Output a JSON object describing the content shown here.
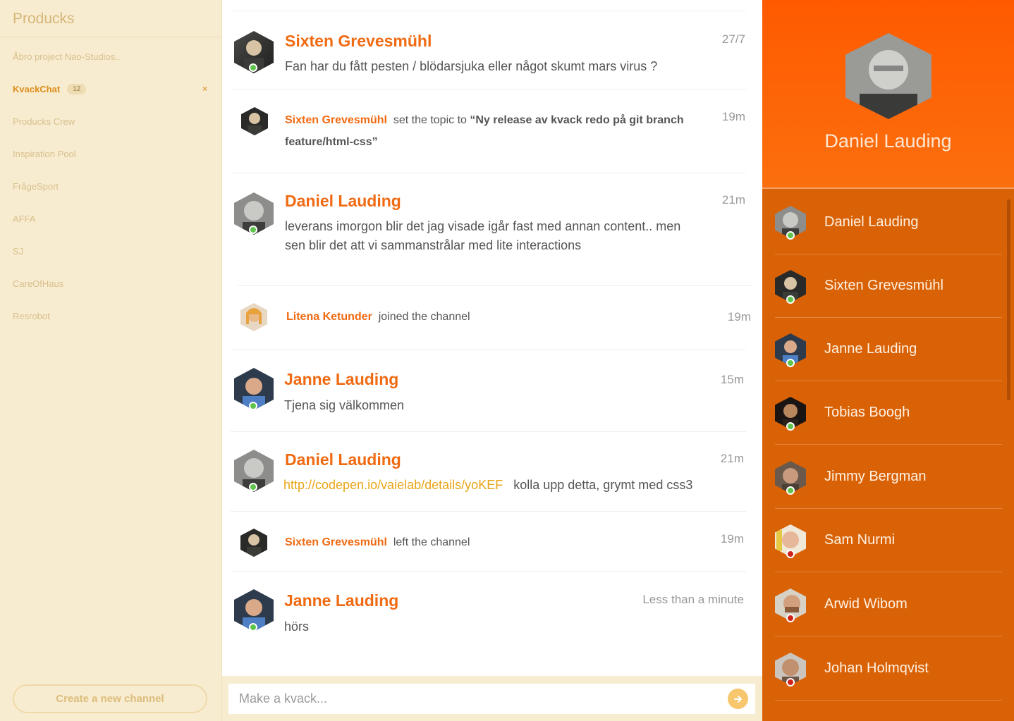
{
  "sidebar": {
    "brand": "Producks",
    "channels": [
      {
        "name": "Åbro project Nao-Studios.."
      },
      {
        "name": "KvackChat",
        "badge": "12",
        "close": "×"
      },
      {
        "name": "Producks Crew"
      },
      {
        "name": "Inspiration Pool"
      },
      {
        "name": "FrågeSport"
      },
      {
        "name": "AFFA"
      },
      {
        "name": "SJ"
      },
      {
        "name": "CareOfHaus"
      },
      {
        "name": "Resrobot"
      }
    ],
    "create_label": "Create a new channel"
  },
  "messages": [
    {
      "author": "Sixten Grevesmühl",
      "text": "Fan har du fått pesten / blödarsjuka eller något skumt mars virus ?",
      "time": "27/7"
    },
    {
      "author": "Sixten Grevesmühl",
      "pre": "set the topic to",
      "topic_line1": "“Ny release av kvack redo på git branch",
      "topic_line2": "feature/html-css”",
      "time": "19m"
    },
    {
      "author": "Daniel Lauding",
      "text_line1": "leverans imorgon blir det jag visade igår fast med annan content.. men",
      "text_line2": "sen blir det att vi sammanstrålar med lite interactions",
      "time": "21m"
    },
    {
      "author": "Litena Ketunder",
      "action": "joined the channel",
      "time": "19m"
    },
    {
      "author": "Janne Lauding",
      "text": "Tjena sig välkommen",
      "time": "15m"
    },
    {
      "author": "Daniel Lauding",
      "link": "http://codepen.io/vaielab/details/yoKEF",
      "text": "kolla upp detta, grymt med css3",
      "time": "21m"
    },
    {
      "author": "Sixten Grevesmühl",
      "action": "left the channel",
      "time": "19m"
    },
    {
      "author": "Janne Lauding",
      "text": "hörs",
      "time": "Less than a minute"
    }
  ],
  "composer": {
    "placeholder": "Make a kvack...",
    "send_icon": "arrow-right-icon"
  },
  "profile": {
    "name": "Daniel Lauding"
  },
  "members": [
    {
      "name": "Daniel Lauding",
      "status": "online"
    },
    {
      "name": "Sixten Grevesmühl",
      "status": "online"
    },
    {
      "name": "Janne Lauding",
      "status": "online"
    },
    {
      "name": "Tobias Boogh",
      "status": "online"
    },
    {
      "name": "Jimmy Bergman",
      "status": "online"
    },
    {
      "name": "Sam Nurmi",
      "status": "offline"
    },
    {
      "name": "Arwid Wibom",
      "status": "offline"
    },
    {
      "name": "Johan Holmqvist",
      "status": "offline"
    }
  ],
  "colors": {
    "accent": "#f06a12",
    "sidebar_bg": "#f8ecd0",
    "right_bg": "#d96206",
    "online": "#5fc44b",
    "offline": "#d0241b",
    "link": "#e8a516"
  }
}
